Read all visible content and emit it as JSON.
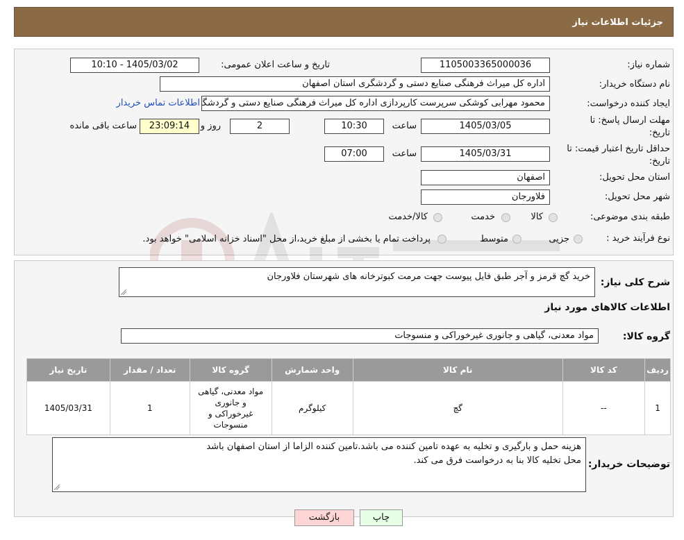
{
  "header": {
    "title": "جزئیات اطلاعات نیاز"
  },
  "fields": {
    "need_number_label": "شماره نیاز:",
    "need_number": "1105003365000036",
    "announce_label": "تاریخ و ساعت اعلان عمومی:",
    "announce_value": "1405/03/02 - 10:10",
    "buyer_org_label": "نام دستگاه خریدار:",
    "buyer_org": "اداره کل میراث فرهنگی  صنایع دستی و گردشگری استان اصفهان",
    "creator_label": "ایجاد کننده درخواست:",
    "creator": "محمود مهرابی کوشکی سرپرست کارپردازی اداره کل میراث فرهنگی  صنایع دستی و گردشگری استان اصفهان",
    "contact_link": "اطلاعات تماس خریدار",
    "send_deadline_label_1": "مهلت ارسال پاسخ: تا",
    "send_deadline_label_2": "تاریخ:",
    "send_date": "1405/03/05",
    "time_label": "ساعت",
    "send_time": "10:30",
    "days": "2",
    "days_and": "روز و",
    "remaining_time": "23:09:14",
    "remaining_label": "ساعت باقی مانده",
    "validity_label_1": "حداقل تاریخ اعتبار قیمت: تا",
    "validity_label_2": "تاریخ:",
    "validity_date": "1405/03/31",
    "validity_time": "07:00",
    "province_label": "استان محل تحویل:",
    "province": "اصفهان",
    "city_label": "شهر محل تحویل:",
    "city": "فلاورجان",
    "category_label": "طبقه بندی موضوعی:",
    "category_options": [
      "کالا",
      "خدمت",
      "کالا/خدمت"
    ],
    "process_label": "نوع فرآیند خرید :",
    "process_options": [
      "جزیی",
      "متوسط"
    ],
    "process_note": "پرداخت تمام یا بخشی از مبلغ خرید،از محل \"اسناد خزانه اسلامی\" خواهد بود."
  },
  "details": {
    "summary_label": "شرح کلی نیاز:",
    "summary": "خرید گچ قرمز و آجر طبق فایل پیوست جهت مرمت کبوترخانه های شهرستان فلاورجان",
    "goods_info_title": "اطلاعات کالاهای مورد نیاز",
    "goods_group_label": "گروه کالا:",
    "goods_group": "مواد معدنی، گیاهی و جانوری غیرخوراکی و منسوجات"
  },
  "table": {
    "headers": [
      "ردیف",
      "کد کالا",
      "نام کالا",
      "واحد شمارش",
      "گروه کالا",
      "تعداد / مقدار",
      "تاریخ نیاز"
    ],
    "rows": [
      [
        "1",
        "--",
        "گچ",
        "کیلوگرم",
        "مواد معدنی، گیاهی و جانوری غیرخوراکی و منسوجات",
        "1",
        "1405/03/31"
      ]
    ]
  },
  "buyer_notes": {
    "label": "توضیحات خریدار:",
    "line1": "هزینه حمل و بارگیری و تخلیه به عهده تامین کننده می باشد.تامین کننده الزاما از استان اصفهان باشد",
    "line2": "محل تخلیه کالا بنا به درخواست فرق می کند."
  },
  "buttons": {
    "print": "چاپ",
    "back": "بازگشت"
  },
  "colors": {
    "header_bg": "#8b6b45",
    "back_btn_bg": "#ffd6d6",
    "print_btn_bg": "#e6ffe6"
  }
}
